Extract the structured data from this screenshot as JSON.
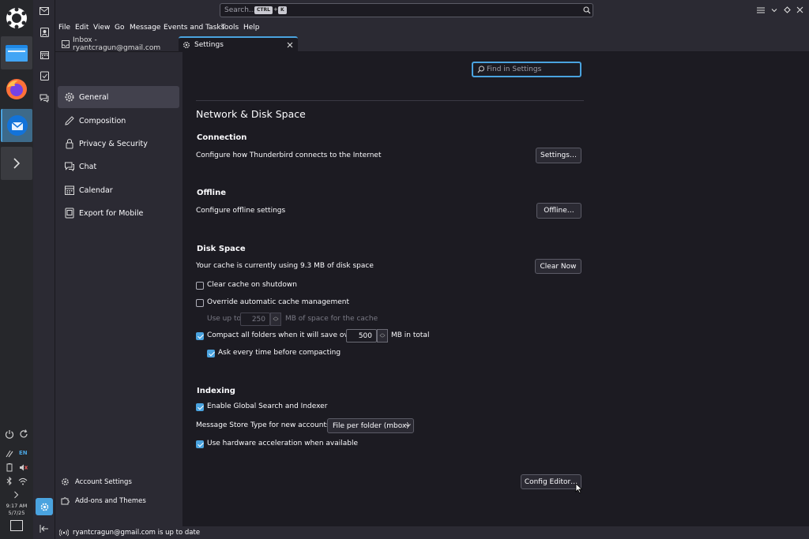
{
  "colors": {
    "accent": "#4aa3df",
    "bg": "#1c1b22",
    "panel": "#2b2a33",
    "selected": "#42414d",
    "taskbar": "#26272b"
  },
  "taskbar": {
    "icons": [
      "kde-menu-icon",
      "file-manager-icon",
      "firefox-icon",
      "thunderbird-icon",
      "expand-icon"
    ],
    "tray": {
      "language": "EN",
      "time": "9:17 AM",
      "date": "5/7/25"
    }
  },
  "global_search": {
    "placeholder": "Search...",
    "shortcut_key1": "CTRL",
    "shortcut_plus": "+",
    "shortcut_key2": "K"
  },
  "menubar": [
    "File",
    "Edit",
    "View",
    "Go",
    "Message",
    "Events and Tasks",
    "Tools",
    "Help"
  ],
  "tabs": [
    {
      "label": "Inbox - ryantcragun@gmail.com",
      "active": false
    },
    {
      "label": "Settings",
      "active": true
    }
  ],
  "sidebar": {
    "categories": [
      {
        "label": "General",
        "icon": "gear-icon",
        "selected": true
      },
      {
        "label": "Composition",
        "icon": "pencil-icon",
        "selected": false
      },
      {
        "label": "Privacy & Security",
        "icon": "lock-icon",
        "selected": false
      },
      {
        "label": "Chat",
        "icon": "chat-icon",
        "selected": false
      },
      {
        "label": "Calendar",
        "icon": "calendar-icon",
        "selected": false
      },
      {
        "label": "Export for Mobile",
        "icon": "phone-icon",
        "selected": false
      }
    ],
    "footer": {
      "account_settings": "Account Settings",
      "addons": "Add-ons and Themes"
    }
  },
  "find": {
    "placeholder": "Find in Settings"
  },
  "section_title": "Network & Disk Space",
  "connection": {
    "heading": "Connection",
    "description": "Configure how Thunderbird connects to the Internet",
    "button": "Settings…"
  },
  "offline": {
    "heading": "Offline",
    "description": "Configure offline settings",
    "button": "Offline…"
  },
  "disk": {
    "heading": "Disk Space",
    "usage_text": "Your cache is currently using 9.3 MB of disk space",
    "clear_button": "Clear Now",
    "clear_on_shutdown": {
      "label": "Clear cache on shutdown",
      "checked": false
    },
    "override": {
      "label": "Override automatic cache management",
      "checked": false
    },
    "use_up_to_label": "Use up to",
    "cache_size": "250",
    "cache_suffix": "MB of space for the cache",
    "compact": {
      "label": "Compact all folders when it will save over",
      "checked": true,
      "value": "500",
      "suffix": "MB in total"
    },
    "ask_compact": {
      "label": "Ask every time before compacting",
      "checked": true
    }
  },
  "indexing": {
    "heading": "Indexing",
    "global_search": {
      "label": "Enable Global Search and Indexer",
      "checked": true
    },
    "store_type_label": "Message Store Type for new accounts:",
    "store_type_value": "File per folder (mbox)",
    "hw_accel": {
      "label": "Use hardware acceleration when available",
      "checked": true
    }
  },
  "config_editor_button": "Config Editor…",
  "status": {
    "text": "ryantcragun@gmail.com is up to date"
  }
}
